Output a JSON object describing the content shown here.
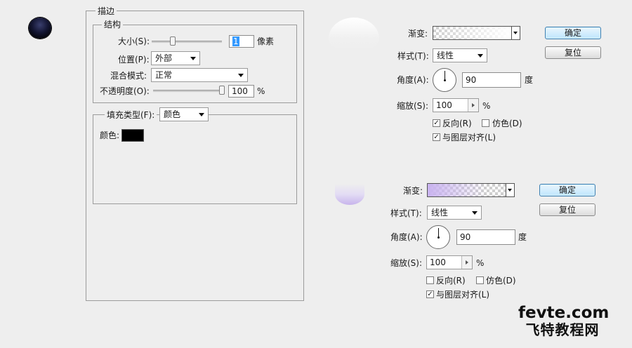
{
  "stroke_panel": {
    "title": "描边",
    "structure": {
      "title": "结构",
      "size_label": "大小(S):",
      "size_value": "1",
      "size_unit": "像素",
      "position_label": "位置(P):",
      "position_value": "外部",
      "blend_label": "混合模式:",
      "blend_value": "正常",
      "opacity_label": "不透明度(O):",
      "opacity_value": "100",
      "opacity_unit": "%"
    },
    "fill": {
      "type_label": "填充类型(F):",
      "type_value": "颜色",
      "color_label": "颜色:",
      "color": "#000000"
    }
  },
  "gradient_dialog_1": {
    "gradient_label": "渐变:",
    "style_label": "样式(T):",
    "style_value": "线性",
    "angle_label": "角度(A):",
    "angle_value": "90",
    "angle_unit": "度",
    "scale_label": "缩放(S):",
    "scale_value": "100",
    "scale_unit": "%",
    "reverse_label": "反向(R)",
    "reverse_checked": true,
    "dither_label": "仿色(D)",
    "dither_checked": false,
    "align_label": "与图层对齐(L)",
    "align_checked": true,
    "ok_label": "确定",
    "reset_label": "复位",
    "gradient_color": "#ffffff"
  },
  "gradient_dialog_2": {
    "gradient_label": "渐变:",
    "style_label": "样式(T):",
    "style_value": "线性",
    "angle_label": "角度(A):",
    "angle_value": "90",
    "angle_unit": "度",
    "scale_label": "缩放(S):",
    "scale_value": "100",
    "scale_unit": "%",
    "reverse_label": "反向(R)",
    "reverse_checked": false,
    "dither_label": "仿色(D)",
    "dither_checked": false,
    "align_label": "与图层对齐(L)",
    "align_checked": true,
    "ok_label": "确定",
    "reset_label": "复位",
    "gradient_color": "#c9b3f0"
  },
  "watermark": {
    "line1": "fevte.com",
    "line2": "飞特教程网"
  },
  "check_mark": "✓"
}
